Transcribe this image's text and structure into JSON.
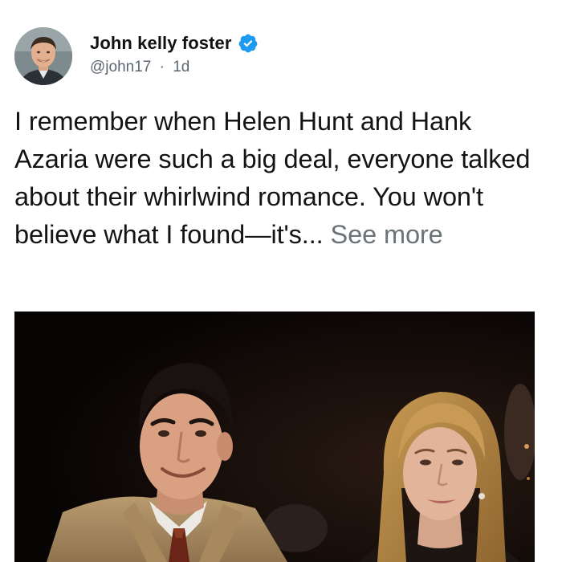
{
  "post": {
    "author_name": "John kelly foster",
    "handle": "@john17",
    "separator": "·",
    "age": "1d",
    "text": "I remember when Helen Hunt and Hank Azaria were such a big deal, everyone talked about their whirlwind romance. You won't believe what I found—it's...",
    "see_more_label": "See more",
    "avatar_icon": "avatar-photo",
    "verified_icon": "verified-badge-icon",
    "photo_icon": "couple-photo"
  },
  "colors": {
    "verified_blue": "#1d9bf0",
    "text": "#141414",
    "muted": "#5b6670",
    "see_more": "#6b7378",
    "photo_background": "#0b0706"
  }
}
